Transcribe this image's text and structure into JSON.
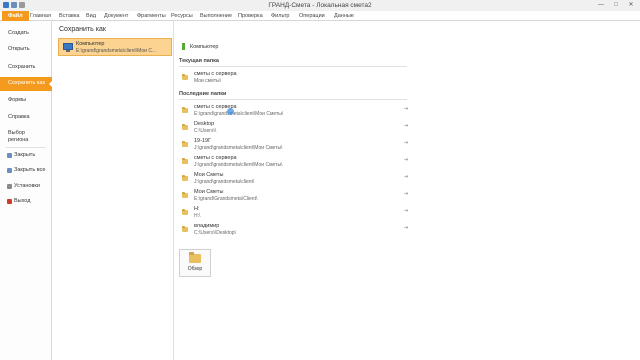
{
  "window": {
    "title": "ГРАНД-Смета - Локальная смета2",
    "controls": [
      "—",
      "□",
      "✕"
    ]
  },
  "ribbon": {
    "tabs": [
      {
        "label": "Файл"
      },
      {
        "label": "Главная"
      },
      {
        "label": "Вставка"
      },
      {
        "label": "Вид"
      },
      {
        "label": "Документ"
      },
      {
        "label": "Фрагменты"
      },
      {
        "label": "Ресурсы"
      },
      {
        "label": "Выполнение"
      },
      {
        "label": "Проверка"
      },
      {
        "label": "Фильтр"
      },
      {
        "label": "Операции"
      },
      {
        "label": "Данные"
      }
    ],
    "active_tab_color": "#f39a1f"
  },
  "sidebar": {
    "items": [
      {
        "label": "Создать"
      },
      {
        "label": "Открыть"
      },
      {
        "label": "Сохранить"
      },
      {
        "label": "Сохранить как",
        "active": true
      },
      {
        "label": "Формы"
      },
      {
        "label": "Справка"
      },
      {
        "label": "Выбор региона"
      }
    ],
    "actions": [
      {
        "label": "Закрыть",
        "icon": "close-doc-icon"
      },
      {
        "label": "Закрыть все",
        "icon": "close-all-icon"
      },
      {
        "label": "Установки",
        "icon": "settings-icon"
      },
      {
        "label": "Выход",
        "icon": "exit-icon"
      }
    ]
  },
  "save_as": {
    "title": "Сохранить как",
    "selected_location": {
      "name": "Компьютер",
      "path": "E:\\grand\\grandsmeta\\client\\Мои С...",
      "icon": "computer-icon"
    }
  },
  "locations": {
    "computer_label": "Компьютер",
    "current_folder_header": "Текущая папка",
    "current_folder": {
      "name": "сметы с сервера",
      "path": "Мои сметы\\"
    },
    "recent_folders_header": "Последние папки",
    "recent": [
      {
        "name": "сметы с сервера",
        "path": "E:\\grand\\grandsmeta\\client\\Мои Сметы\\"
      },
      {
        "name": "Desktop",
        "path": "C:\\Users\\\\"
      },
      {
        "name": "19-19Г",
        "path": "J:\\grand\\grandsmeta\\client\\Мои Сметы\\"
      },
      {
        "name": "сметы с сервера",
        "path": "J:\\grand\\grandsmeta\\client\\Мои Сметы\\"
      },
      {
        "name": "Мои Сметы",
        "path": "J:\\grand\\grandsmeta\\client\\"
      },
      {
        "name": "Мои Сметы",
        "path": "E:\\grand\\Grandsmeta\\Client\\"
      },
      {
        "name": "H:",
        "path": "H:\\"
      },
      {
        "name": "владимир",
        "path": "C:\\Users\\\\Desktop\\"
      }
    ],
    "browse_label": "Обзор"
  },
  "colors": {
    "accent": "#f39a1f",
    "selection": "#fcd390"
  }
}
